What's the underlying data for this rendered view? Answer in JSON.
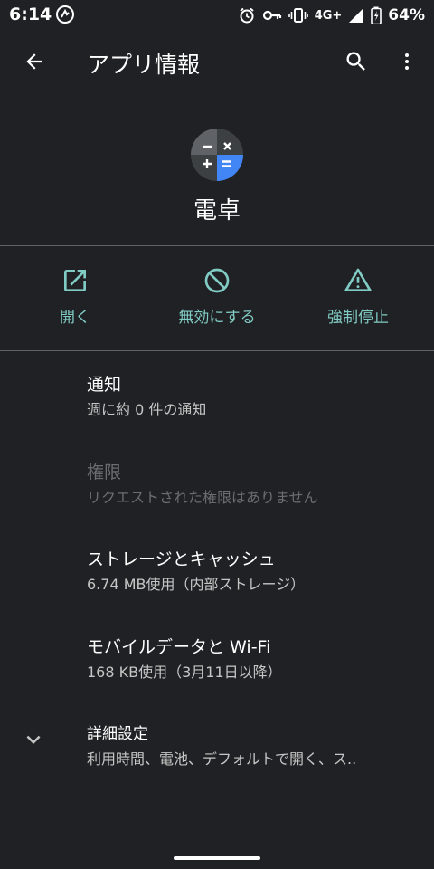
{
  "status_bar": {
    "time": "6:14",
    "network": "4G+",
    "battery": "64%"
  },
  "app_bar": {
    "title": "アプリ情報"
  },
  "app": {
    "name": "電卓"
  },
  "actions": [
    {
      "label": "開く",
      "icon": "open-in-new-icon"
    },
    {
      "label": "無効にする",
      "icon": "disable-icon"
    },
    {
      "label": "強制停止",
      "icon": "warning-icon"
    }
  ],
  "items": [
    {
      "title": "通知",
      "subtitle": "週に約 0 件の通知"
    },
    {
      "title": "権限",
      "subtitle": "リクエストされた権限はありません"
    },
    {
      "title": "ストレージとキャッシュ",
      "subtitle": "6.74 MB使用（内部ストレージ）"
    },
    {
      "title": "モバイルデータと Wi-Fi",
      "subtitle": "168 KB使用（3月11日以降）"
    },
    {
      "title": "詳細設定",
      "subtitle": "利用時間、電池、デフォルトで開く、ス.."
    }
  ],
  "colors": {
    "background": "#202124",
    "accent": "#80cbc4",
    "divider": "#5f6368",
    "calc_blue": "#4285f4",
    "calc_gray": "#5f6368"
  }
}
